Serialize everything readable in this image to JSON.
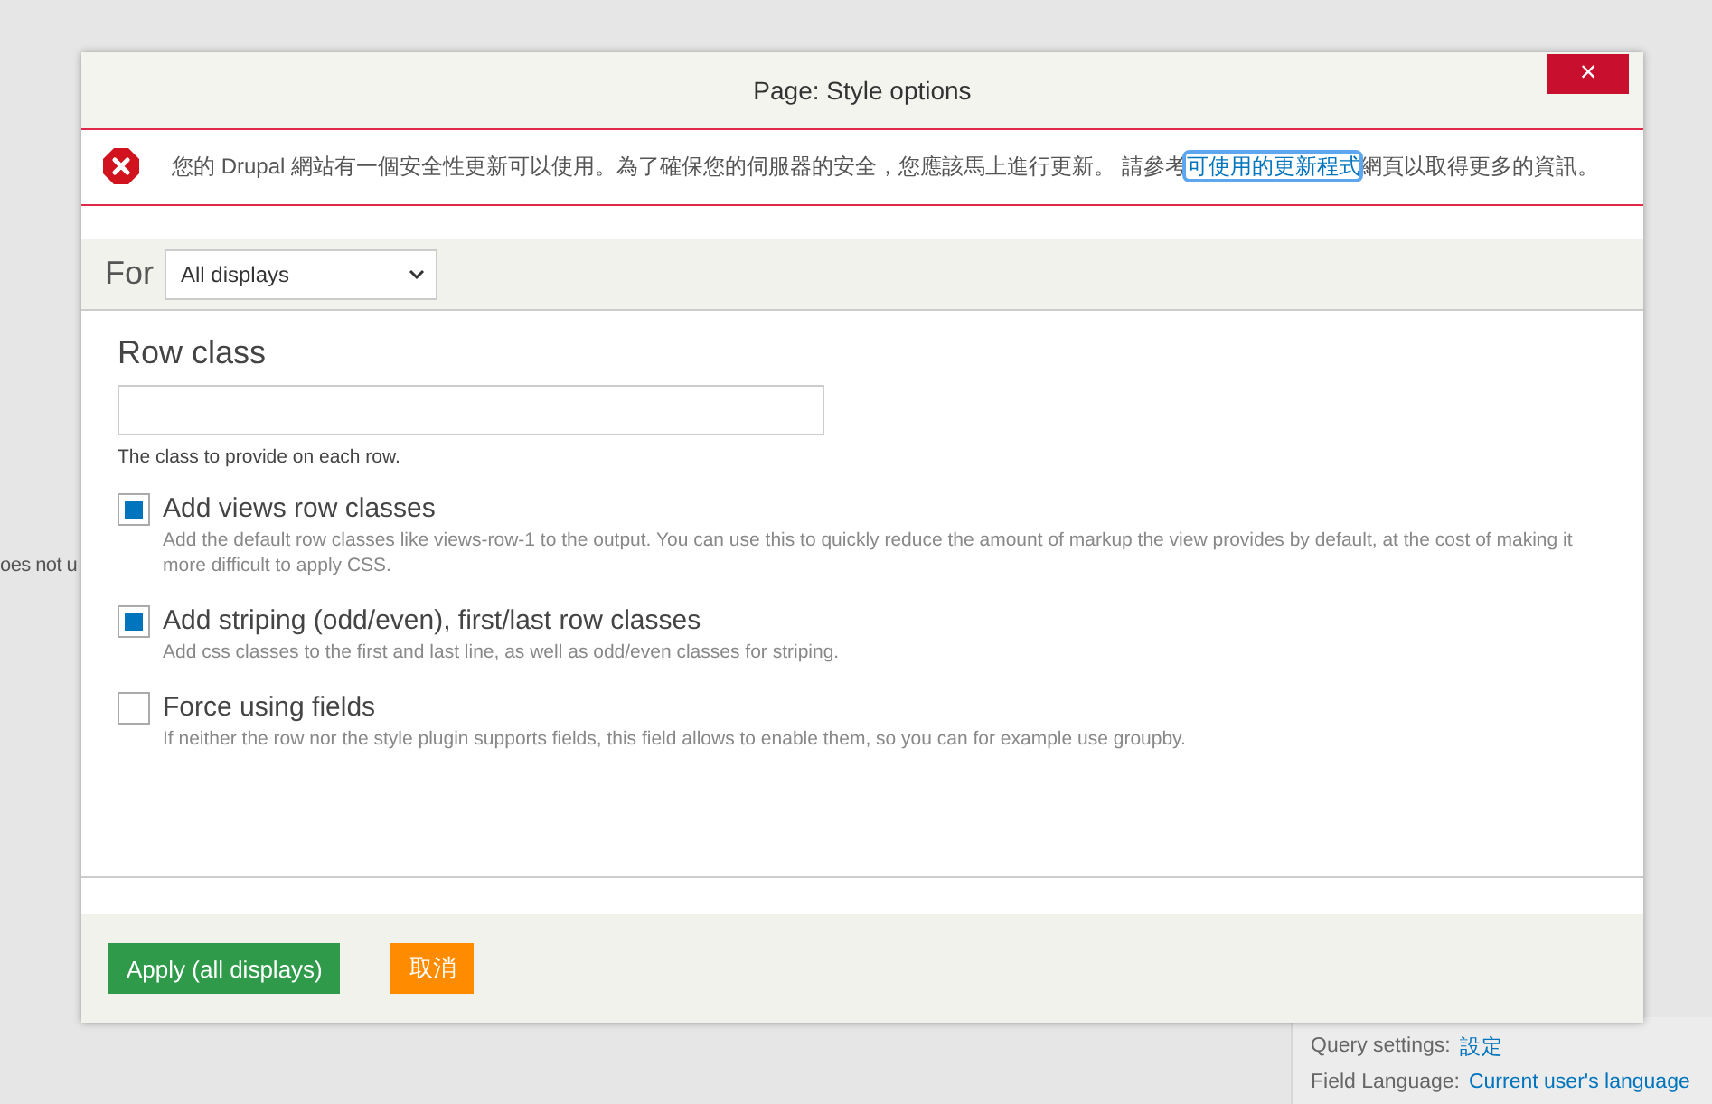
{
  "background": {
    "left_fragment": "oes not u",
    "settings": [
      {
        "label": "Query settings:",
        "link": "設定"
      },
      {
        "label": "Field Language:",
        "link": "Current user's language"
      }
    ]
  },
  "dialog": {
    "title": "Page: Style options",
    "close": "×"
  },
  "message": {
    "kind": "error",
    "before": "您的 Drupal 網站有一個安全性更新可以使用。為了確保您的伺服器的安全，您應該馬上進行更新。 請參考",
    "link": "可使用的更新程式",
    "link_focused": true,
    "after": "網頁以取得更多的資訊。"
  },
  "for": {
    "label": "For",
    "value": "All displays"
  },
  "row_class": {
    "label": "Row class",
    "description": "The class to provide on each row."
  },
  "options": [
    {
      "label": "Add views row classes",
      "checked": true,
      "description": "Add the default row classes like views-row-1 to the output. You can use this to quickly reduce the amount of markup the view provides by default, at the cost of making it more difficult to apply CSS."
    },
    {
      "label": "Add striping (odd/even), first/last row classes",
      "checked": true,
      "description": "Add css classes to the first and last line, as well as odd/even classes for striping."
    },
    {
      "label": "Force using fields",
      "checked": false,
      "description": "If neither the row nor the style plugin supports fields, this field allows to enable them, so you can for example use groupby."
    }
  ],
  "buttons": [
    {
      "label": "Apply (all displays)",
      "kind": "primary"
    },
    {
      "label": "取消",
      "kind": "cancel"
    }
  ]
}
